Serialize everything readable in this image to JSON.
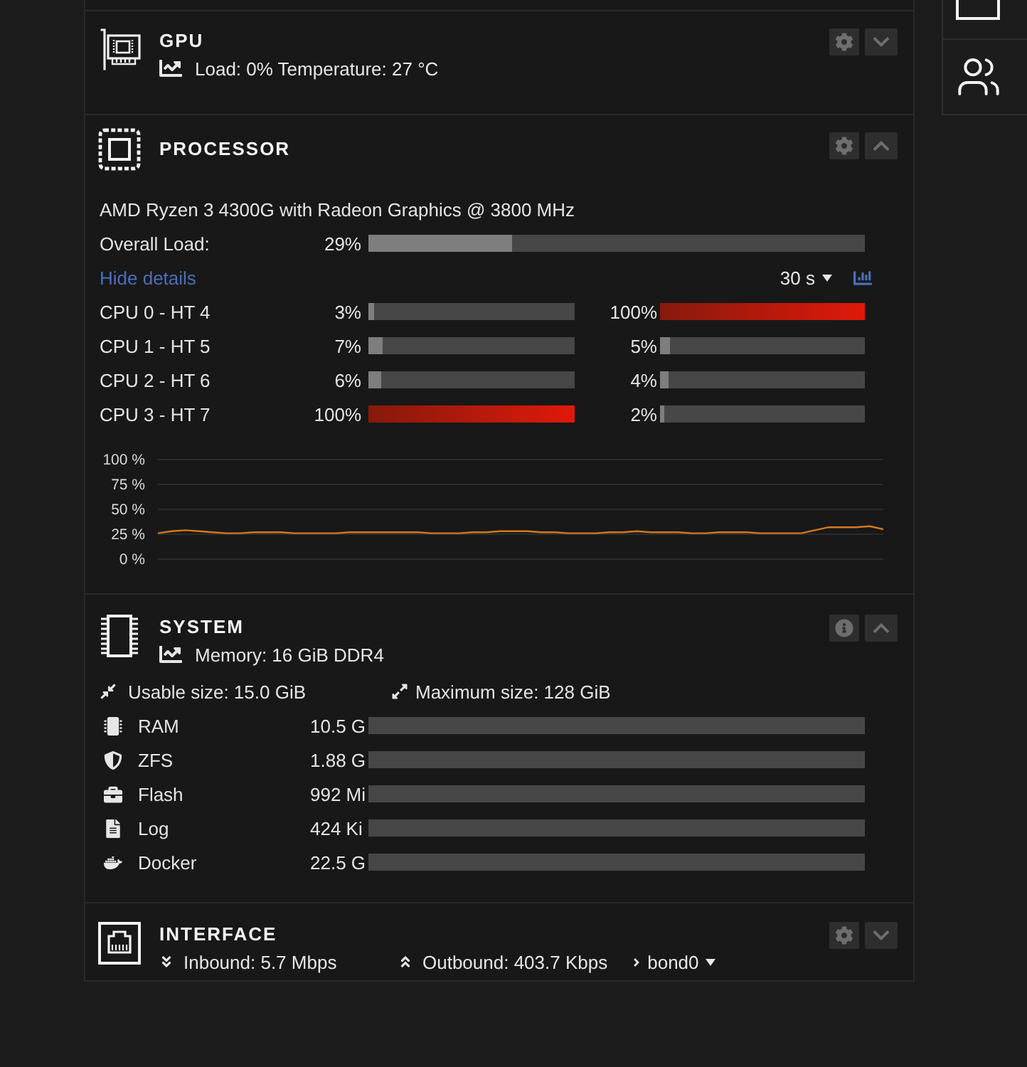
{
  "panels": [
    {
      "kind": "gpu",
      "title": "GPU",
      "expanded": false,
      "subtitle": "Load: 0% Temperature: 27 °C"
    },
    {
      "kind": "processor",
      "title": "PROCESSOR",
      "expanded": true,
      "model": "AMD Ryzen 3 4300G with Radeon Graphics @ 3800 MHz",
      "overall": {
        "label": "Overall Load:",
        "value": "29%",
        "level": 0.29
      },
      "details_link": "Hide details",
      "period": "30 s",
      "cores": [
        {
          "label": "CPU 0 - HT 4",
          "threads": [
            {
              "value": "3%",
              "level": 0.03
            },
            {
              "value": "100%",
              "level": 1
            }
          ]
        },
        {
          "label": "CPU 1 - HT 5",
          "threads": [
            {
              "value": "7%",
              "level": 0.07
            },
            {
              "value": "5%",
              "level": 0.05
            }
          ]
        },
        {
          "label": "CPU 2 - HT 6",
          "threads": [
            {
              "value": "6%",
              "level": 0.06
            },
            {
              "value": "4%",
              "level": 0.04
            }
          ]
        },
        {
          "label": "CPU 3 - HT 7",
          "threads": [
            {
              "value": "100%",
              "level": 1
            },
            {
              "value": "2%",
              "level": 0.02
            }
          ]
        }
      ],
      "chart_data": {
        "type": "line",
        "values": [
          26,
          28,
          29,
          28,
          27,
          26,
          26,
          27,
          27,
          27,
          26,
          26,
          26,
          26,
          27,
          27,
          27,
          27,
          27,
          27,
          26,
          26,
          26,
          27,
          27,
          28,
          28,
          28,
          27,
          27,
          26,
          26,
          26,
          27,
          27,
          28,
          27,
          27,
          27,
          26,
          26,
          27,
          27,
          27,
          26,
          26,
          26,
          26,
          29,
          32,
          32,
          32,
          33,
          30
        ],
        "ylim": [
          0,
          100
        ],
        "yticks": [
          {
            "value": 0,
            "label": "0 %"
          },
          {
            "value": 25,
            "label": "25 %"
          },
          {
            "value": 50,
            "label": "50 %"
          },
          {
            "value": 75,
            "label": "75 %"
          },
          {
            "value": 100,
            "label": "100 %"
          }
        ],
        "grid": true
      }
    },
    {
      "kind": "system",
      "title": "SYSTEM",
      "expanded": true,
      "subtitle": "Memory: 16 GiB DDR4",
      "usable": "Usable size: 15.0 GiB",
      "maximum": "Maximum size: 128 GiB",
      "memory": [
        {
          "kind": "ram",
          "label": "RAM",
          "value": "10.5 G"
        },
        {
          "kind": "zfs",
          "label": "ZFS",
          "value": "1.88 G"
        },
        {
          "kind": "flash",
          "label": "Flash",
          "value": "992 Mi"
        },
        {
          "kind": "log",
          "label": "Log",
          "value": "424 Ki"
        },
        {
          "kind": "docker",
          "label": "Docker",
          "value": "22.5 G"
        }
      ]
    },
    {
      "kind": "interface",
      "title": "INTERFACE",
      "expanded": false,
      "inbound": "Inbound: 5.7 Mbps",
      "outbound": "Outbound: 403.7 Kbps",
      "interface": "bond0"
    }
  ]
}
